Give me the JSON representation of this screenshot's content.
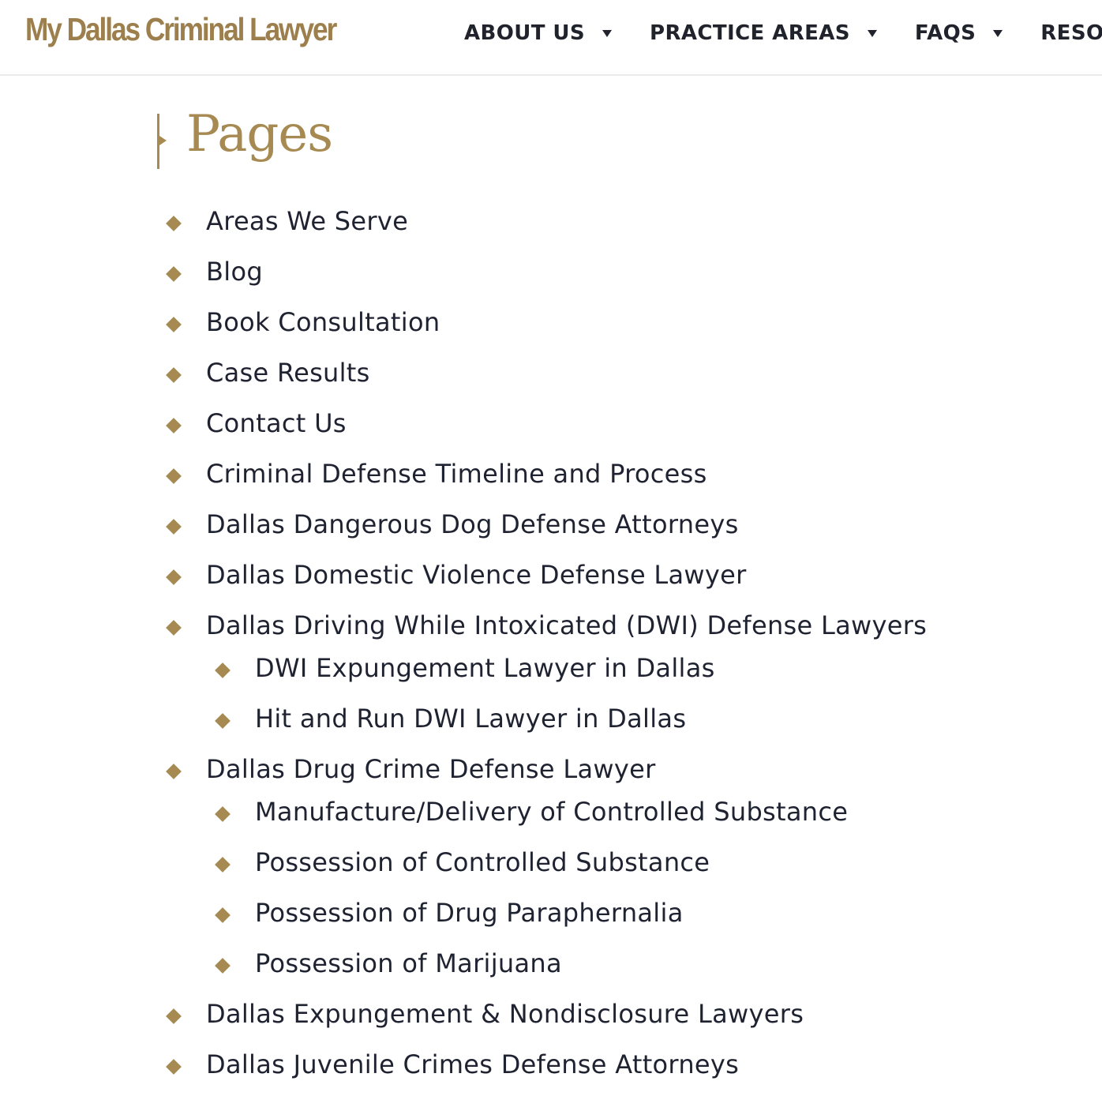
{
  "header": {
    "logo_text": "My Dallas Criminal Lawyer",
    "nav": [
      {
        "label": "ABOUT US",
        "has_dropdown": true
      },
      {
        "label": "PRACTICE AREAS",
        "has_dropdown": true
      },
      {
        "label": "FAQS",
        "has_dropdown": true
      },
      {
        "label": "RESOURCES",
        "has_dropdown": false
      }
    ]
  },
  "main": {
    "title": "Pages",
    "pages": [
      {
        "label": "Areas We Serve",
        "level": 1
      },
      {
        "label": "Blog",
        "level": 1
      },
      {
        "label": "Book Consultation",
        "level": 1
      },
      {
        "label": "Case Results",
        "level": 1
      },
      {
        "label": "Contact Us",
        "level": 1
      },
      {
        "label": "Criminal Defense Timeline and Process",
        "level": 1
      },
      {
        "label": "Dallas Dangerous Dog Defense Attorneys",
        "level": 1
      },
      {
        "label": "Dallas Domestic Violence Defense Lawyer",
        "level": 1
      },
      {
        "label": "Dallas Driving While Intoxicated (DWI) Defense Lawyers",
        "level": 1
      },
      {
        "label": "DWI Expungement Lawyer in Dallas",
        "level": 2
      },
      {
        "label": "Hit and Run DWI Lawyer in Dallas",
        "level": 2
      },
      {
        "label": "Dallas Drug Crime Defense Lawyer",
        "level": 1
      },
      {
        "label": "Manufacture/Delivery of Controlled Substance",
        "level": 2
      },
      {
        "label": "Possession of Controlled Substance",
        "level": 2
      },
      {
        "label": "Possession of Drug Paraphernalia",
        "level": 2
      },
      {
        "label": "Possession of Marijuana",
        "level": 2
      },
      {
        "label": "Dallas Expungement & Nondisclosure Lawyers",
        "level": 1
      },
      {
        "label": "Dallas Juvenile Crimes Defense Attorneys",
        "level": 1
      }
    ]
  },
  "colors": {
    "accent_gold": "#a68a52",
    "text_dark": "#1f2230"
  }
}
